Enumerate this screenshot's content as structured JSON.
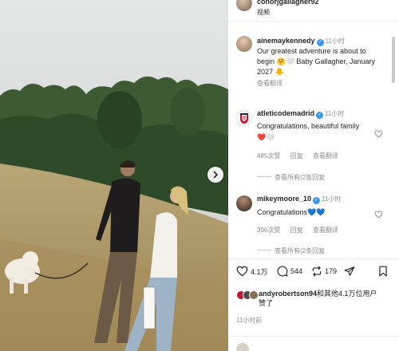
{
  "post": {
    "author": "conorjgallagher92",
    "author_sub": "视频"
  },
  "comments": [
    {
      "user": "ainemaykennedy",
      "time": "11小时",
      "lines": [
        "Our greatest adventure is about to",
        "begin 🤗🤍 Baby Gallagher, January",
        "2027 🐥"
      ],
      "meta": [
        "查看翻译"
      ]
    },
    {
      "user": "atleticodemadrid",
      "time": "11小时",
      "lines": [
        "Congratulations, beautiful family",
        "❤️🤍"
      ],
      "meta": [
        "485次赞",
        "回复",
        "查看翻译"
      ],
      "replies": "查看所有(2条回复"
    },
    {
      "user": "mikeymoore_10",
      "time": "11小时",
      "lines": [
        "Congratulations💙💙"
      ],
      "meta": [
        "396次赞",
        "回复",
        "查看翻译"
      ],
      "replies": "查看所有(2条回复"
    }
  ],
  "actions": {
    "likes": "4.1万",
    "comments": "544",
    "reposts": "179"
  },
  "liked_by": {
    "user": "andyrobertson94",
    "rest_line1": "和其他4.1万位用户",
    "rest_line2": "赞了"
  },
  "post_time": "11小时前",
  "icons": {
    "carousel": "chevron-right-icon",
    "like": "heart-icon",
    "comment": "comment-icon",
    "repost": "repost-icon",
    "share": "send-icon",
    "save": "bookmark-icon"
  },
  "colors": {
    "verified": "#3897f0",
    "muted": "#8e8e8e",
    "text": "#262626"
  }
}
